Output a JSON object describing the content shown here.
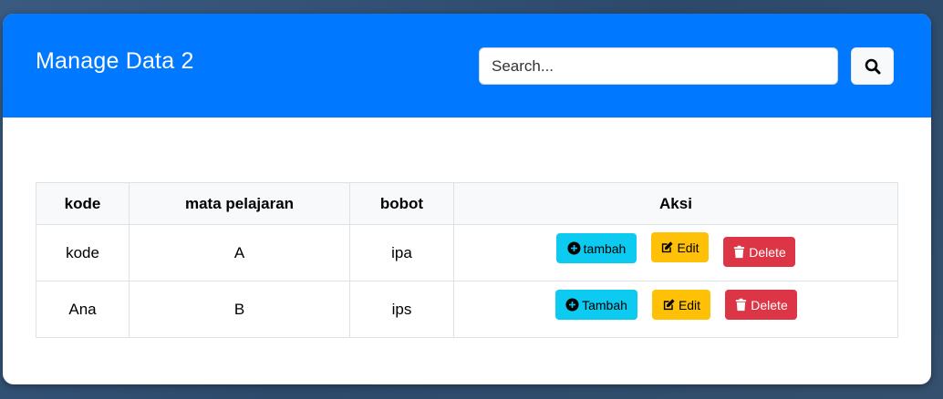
{
  "header": {
    "title": "Manage Data 2",
    "search_placeholder": "Search...",
    "search_icon": "search-icon"
  },
  "table": {
    "columns": [
      "kode",
      "mata pelajaran",
      "bobot",
      "Aksi"
    ],
    "rows": [
      {
        "kode": "kode",
        "mapel": "A",
        "bobot": "ipa",
        "add_label": "tambah",
        "edit_label": "Edit",
        "delete_label": "Delete"
      },
      {
        "kode": "Ana",
        "mapel": "B",
        "bobot": "ips",
        "add_label": "Tambah",
        "edit_label": "Edit",
        "delete_label": "Delete"
      }
    ]
  },
  "colors": {
    "header_bg": "#0078ff",
    "info": "#0dcaf0",
    "warning": "#ffc107",
    "danger": "#dc3545"
  }
}
